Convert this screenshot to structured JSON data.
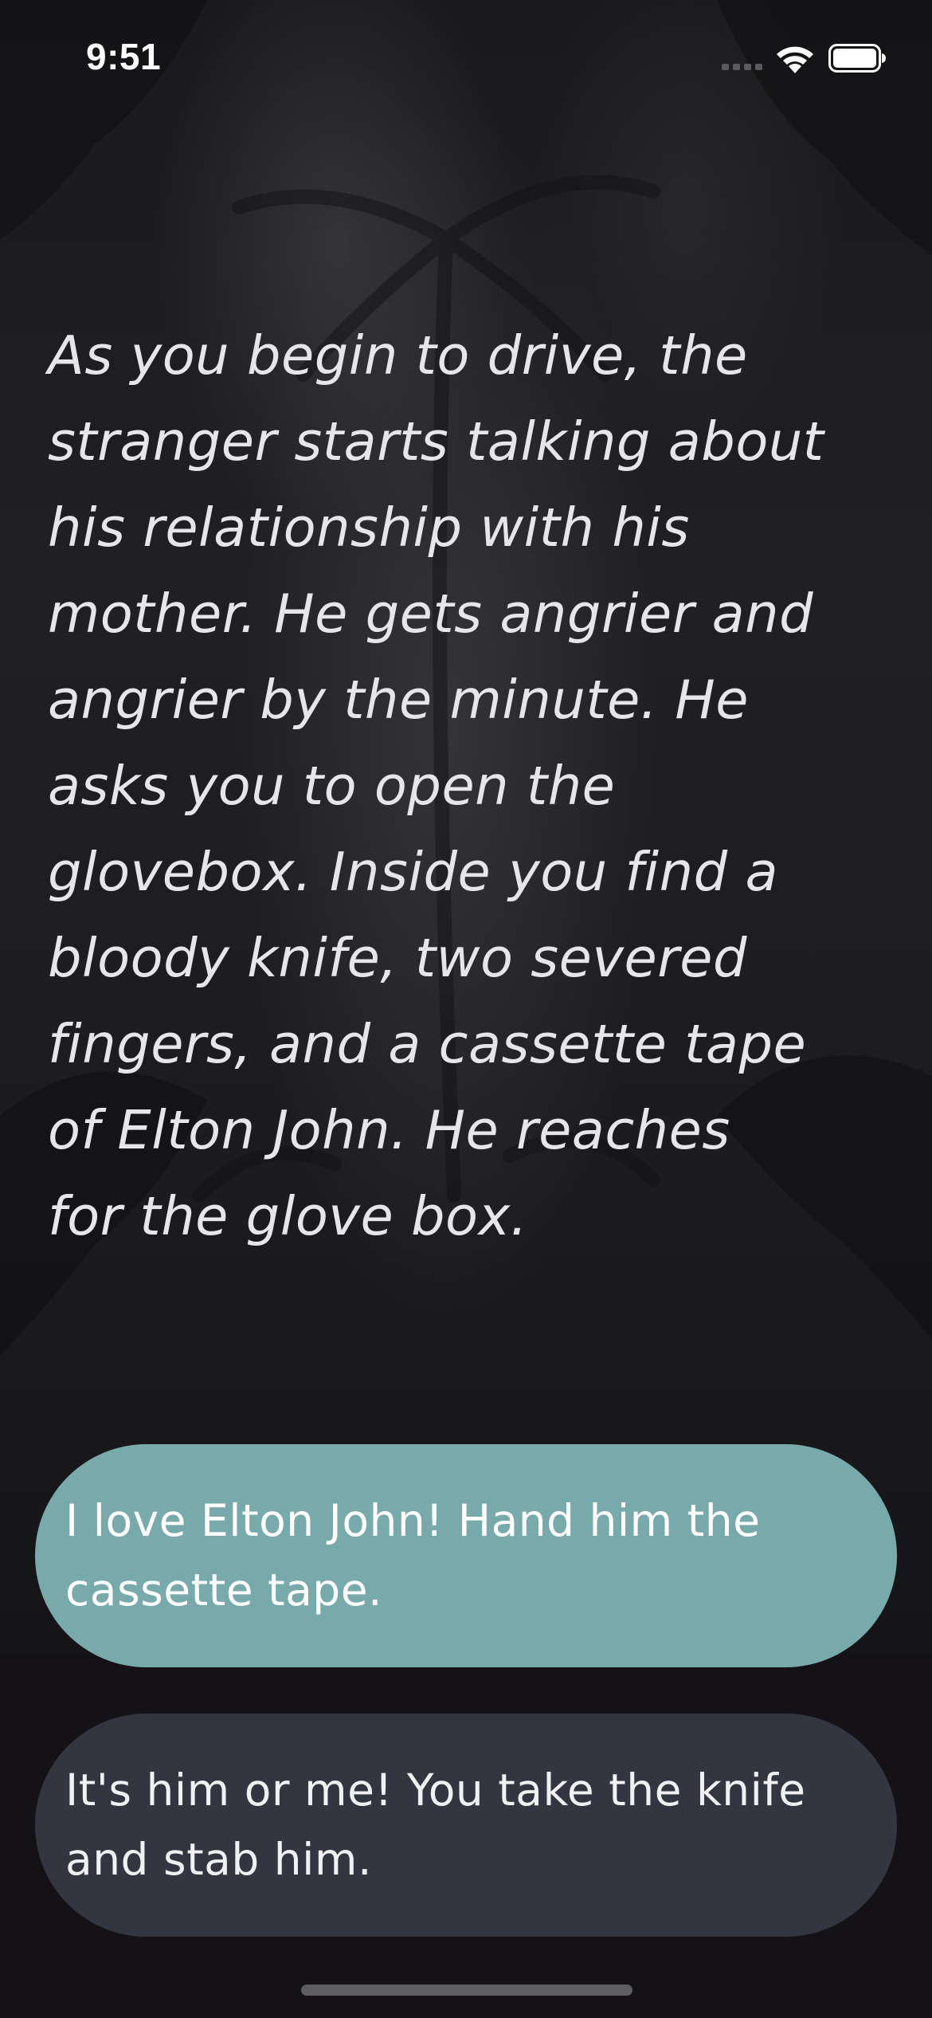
{
  "status_bar": {
    "time": "9:51",
    "icons": [
      "cellular-signal-icon",
      "wifi-icon",
      "battery-icon"
    ]
  },
  "story": {
    "text": "As you begin to drive, the\nstranger starts talking about\nhis relationship with his\nmother. He gets angrier and\nangrier by the minute. He\nasks you to open the\nglovebox. Inside you find a\nbloody knife, two severed\nfingers, and a cassette tape\nof Elton John. He reaches\nfor the glove box."
  },
  "choices": [
    {
      "label": "I love Elton John! Hand him the\ncassette tape.",
      "color": "#78aaac"
    },
    {
      "label": "It's him or me! You take the knife\nand stab him.",
      "color": "#333640"
    }
  ],
  "colors": {
    "background": "#141217",
    "choice_primary": "#78aaac",
    "choice_secondary": "#333640",
    "text": "#e6e5ea"
  }
}
